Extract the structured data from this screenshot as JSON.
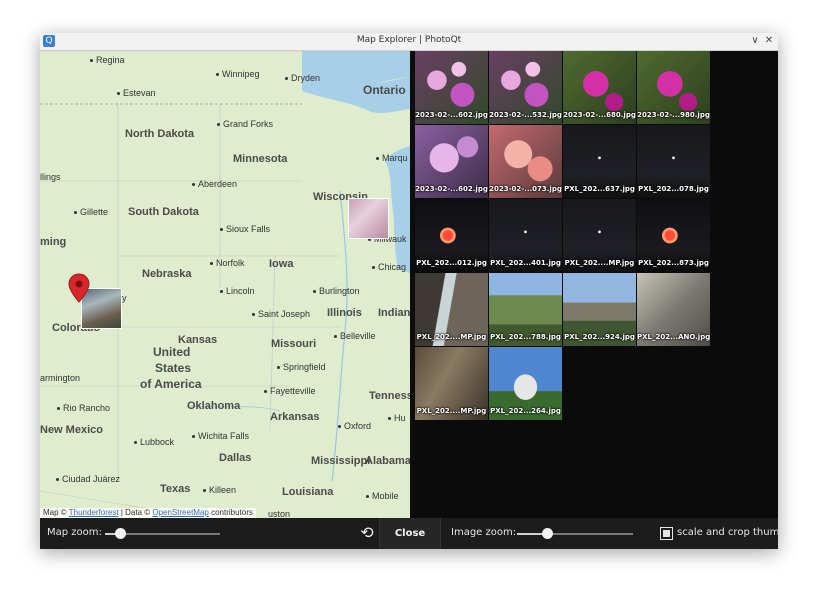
{
  "window": {
    "title": "Map Explorer | PhotoQt",
    "app_icon_glyph": "Q",
    "minimize_glyph": "∨",
    "close_glyph": "✕"
  },
  "map": {
    "labels": {
      "regina": "Regina",
      "winnipeg": "Winnipeg",
      "dryden": "Dryden",
      "estevan": "Estevan",
      "ontario": "Ontario",
      "north_dakota": "North Dakota",
      "grand_forks": "Grand Forks",
      "minnesota": "Minnesota",
      "marquette": "Marqu",
      "billings": "llings",
      "aberdeen": "Aberdeen",
      "wisconsin": "Wisconsin",
      "gillette": "Gillette",
      "south_dakota": "South Dakota",
      "sioux_falls": "Sioux Falls",
      "milwaukee": "Milwauk",
      "wyoming": "ming",
      "nebraska": "Nebraska",
      "norfolk": "Norfolk",
      "iowa": "Iowa",
      "chicago": "Chicag",
      "lincoln": "Lincoln",
      "burlington": "Burlington",
      "colorado": "Colorado",
      "kansas": "Kansas",
      "saint_joseph": "Saint Joseph",
      "illinois": "Illinois",
      "indiana": "Indian",
      "usa_1": "United",
      "usa_2": "States",
      "usa_3": "of America",
      "missouri": "Missouri",
      "belleville": "Belleville",
      "farmington": "armington",
      "springfield": "Springfield",
      "fayetteville": "Fayetteville",
      "tennessee": "Tenness",
      "rio_rancho": "Rio Rancho",
      "oklahoma": "Oklahoma",
      "arkansas": "Arkansas",
      "huntsville": "Hu",
      "new_mexico": "New Mexico",
      "lubbock": "Lubbock",
      "wichita_falls": "Wichita Falls",
      "oxford": "Oxford",
      "dallas": "Dallas",
      "mississippi": "Mississippi",
      "alabama": "Alabama",
      "ciudad_juarez": "Ciudad Juárez",
      "texas": "Texas",
      "killeen": "Killeen",
      "louisiana": "Louisiana",
      "mobile": "Mobile",
      "houston": "uston",
      "city_partial_near_marker": "y"
    },
    "attribution": {
      "prefix": "Map ©",
      "thunderforest": "Thunderforest",
      "middle": "| Data ©",
      "osm": "OpenStreetMap",
      "suffix": "contributors"
    },
    "colors": {
      "land": "#dfeccd",
      "water": "#a8cfe8",
      "pin": "#d9262a"
    }
  },
  "thumbnails": [
    {
      "caption": "2023-02-...602.jpg",
      "kind": "orchid-purple"
    },
    {
      "caption": "2023-02-...532.jpg",
      "kind": "orchid-purple"
    },
    {
      "caption": "2023-02-...680.jpg",
      "kind": "orchid-magenta"
    },
    {
      "caption": "2023-02-...980.jpg",
      "kind": "orchid-magenta"
    },
    {
      "caption": "2023-02-...602.jpg",
      "kind": "orchid-lilac"
    },
    {
      "caption": "2023-02-...073.jpg",
      "kind": "orchid-pink"
    },
    {
      "caption": "PXL_202...637.jpg",
      "kind": "night"
    },
    {
      "caption": "PXL_202...078.jpg",
      "kind": "night"
    },
    {
      "caption": "PXL_202...012.jpg",
      "kind": "night-firework"
    },
    {
      "caption": "PXL_202...401.jpg",
      "kind": "night"
    },
    {
      "caption": "PXL_202....MP.jpg",
      "kind": "night"
    },
    {
      "caption": "PXL_202...873.jpg",
      "kind": "night-firework"
    },
    {
      "caption": "PXL_202....MP.jpg",
      "kind": "waterfall"
    },
    {
      "caption": "PXL_202...788.jpg",
      "kind": "valley"
    },
    {
      "caption": "PXL_202...924.jpg",
      "kind": "mountain"
    },
    {
      "caption": "PXL_202...ANO.jpg",
      "kind": "rock"
    },
    {
      "caption": "PXL_202....MP.jpg",
      "kind": "cliff"
    },
    {
      "caption": "PXL_202...264.jpg",
      "kind": "temple"
    }
  ],
  "bottombar": {
    "map_zoom_label": "Map zoom:",
    "map_zoom_value": 0.13,
    "reset_glyph": "⟲",
    "close_label": "Close",
    "image_zoom_label": "Image zoom:",
    "image_zoom_value": 0.26,
    "scale_crop_label": "scale and crop thumbnails",
    "scale_crop_checked": true
  }
}
